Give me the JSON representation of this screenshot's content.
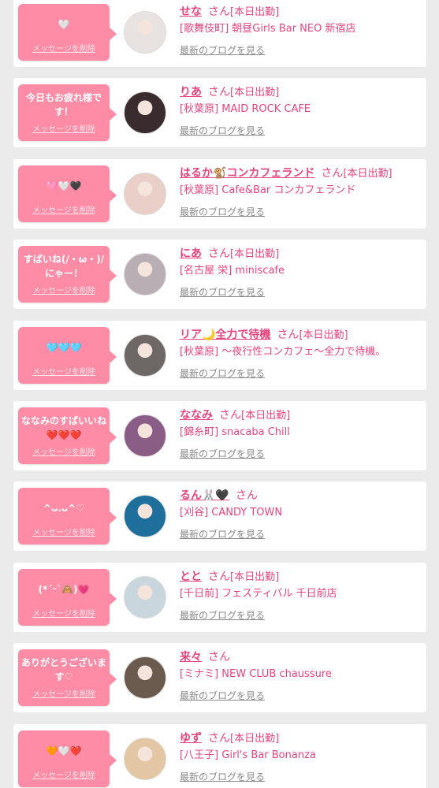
{
  "common": {
    "delete_label": "メッセージを削除",
    "blog_label": "最新のブログを見る",
    "san": "さん"
  },
  "cards": [
    {
      "message": "🤍",
      "name": "せな",
      "status": "[本日出勤]",
      "shop": "[歌舞伎町] 朝昼Girls Bar NEO 新宿店",
      "avatar_color": "#e8e2e0"
    },
    {
      "message": "今日もお疲れ様です！",
      "name": "りあ",
      "status": "[本日出勤]",
      "shop": "[秋葉原] MAID ROCK CAFE",
      "avatar_color": "#3a2b2e"
    },
    {
      "message": "🩷🤍🖤",
      "name": "はるか🐒コンカフェランド",
      "status": "[本日出勤]",
      "shop": "[秋葉原] Cafe&Bar コンカフェランド",
      "avatar_color": "#e9cfc8"
    },
    {
      "message": "すばいね(/・ω・)/にゃー！",
      "name": "にあ",
      "status": "[本日出勤]",
      "shop": "[名古屋 栄] miniscafe",
      "avatar_color": "#b8aeb4"
    },
    {
      "message": "🩵🩵🩵",
      "name": "リア🌙全力で待機",
      "status": "[本日出勤]",
      "shop": "[秋葉原] 〜夜行性コンカフェ〜全力で待機。",
      "avatar_color": "#6d6866"
    },
    {
      "message": "ななみのすばいいね❤️❤️❤️",
      "name": "ななみ",
      "status": "[本日出勤]",
      "shop": "[錦糸町] snacaba Chill",
      "avatar_color": "#8a5d86"
    },
    {
      "message": "^ᴗ.ᴗ^♡",
      "name": "るん🐰🖤",
      "status": "",
      "shop": "[刈谷] CANDY TOWN",
      "avatar_color": "#1f6f9c"
    },
    {
      "message": "(*´ᵕ`🙈)💗",
      "name": "とと",
      "status": "[本日出勤]",
      "shop": "[千日前] フェスティバル 千日前店",
      "avatar_color": "#c9d6dd"
    },
    {
      "message": "ありがとうございます♡",
      "name": "来々",
      "status": "",
      "shop": "[ミナミ] NEW CLUB chaussure",
      "avatar_color": "#6b5a4e"
    },
    {
      "message": "🧡🤍❤️",
      "name": "ゆず",
      "status": "[本日出勤]",
      "shop": "[八王子] Girl's Bar Bonanza",
      "avatar_color": "#e3c7a4"
    }
  ]
}
